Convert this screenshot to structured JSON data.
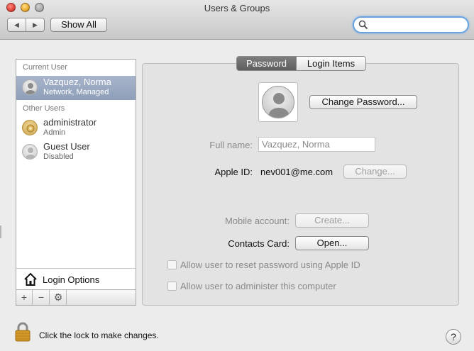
{
  "window": {
    "title": "Users & Groups"
  },
  "toolbar": {
    "back_label": "◀",
    "forward_label": "▶",
    "show_all_label": "Show All",
    "search": {
      "value": "",
      "placeholder": ""
    }
  },
  "sidebar": {
    "current_user_header": "Current User",
    "other_users_header": "Other Users",
    "current_user": {
      "name": "Vazquez, Norma",
      "subtitle": "Network, Managed"
    },
    "other_users": [
      {
        "name": "administrator",
        "subtitle": "Admin"
      },
      {
        "name": "Guest User",
        "subtitle": "Disabled"
      }
    ],
    "login_options_label": "Login Options",
    "add_label": "+",
    "remove_label": "−",
    "action_label": "⚙"
  },
  "tabs": [
    {
      "label": "Password",
      "active": true
    },
    {
      "label": "Login Items",
      "active": false
    }
  ],
  "password_pane": {
    "change_password_label": "Change Password...",
    "full_name_label": "Full name:",
    "full_name_value": "Vazquez, Norma",
    "apple_id_label": "Apple ID:",
    "apple_id_value": "nev001@me.com",
    "apple_id_change_label": "Change...",
    "mobile_account_label": "Mobile account:",
    "mobile_account_button": "Create...",
    "contacts_card_label": "Contacts Card:",
    "contacts_card_button": "Open...",
    "reset_password_checkbox": "Allow user to reset password using Apple ID",
    "administer_checkbox": "Allow user to administer this computer"
  },
  "footer": {
    "lock_text": "Click the lock to make changes.",
    "help_label": "?"
  },
  "colors": {
    "selection": "#95a4be",
    "search_focus": "#6aa2e0",
    "active_tab": "#6e6e6e",
    "lock_gold": "#d39a2a"
  }
}
